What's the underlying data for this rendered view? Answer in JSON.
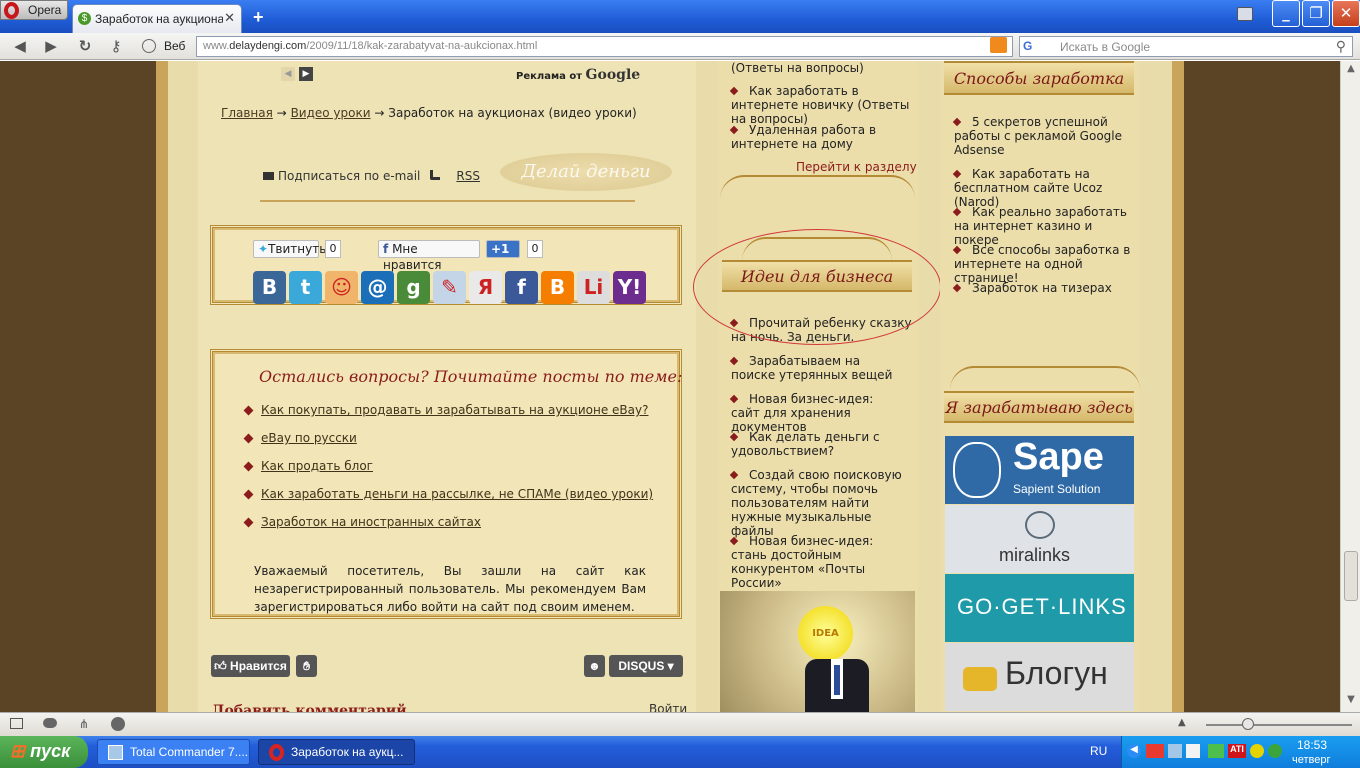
{
  "browser": {
    "menu_label": "Opera",
    "tab_title": "Заработок на аукциона...",
    "tab_favicon": "$",
    "new_tab": "+",
    "window_controls": [
      "_",
      "❐",
      "✕"
    ]
  },
  "toolbar": {
    "web_label": "Веб",
    "address_prefix": "www.",
    "address_domain": "delaydengi.com",
    "address_path": "/2009/11/18/kak-zarabatyvat-na-aukcionax.html",
    "search_engine": "G",
    "search_placeholder": "Искать в Google"
  },
  "ad": {
    "label": "Реклама от",
    "brand": "Google"
  },
  "breadcrumb": {
    "home": "Главная",
    "sep": "→",
    "section": "Видео уроки",
    "current": "Заработок на аукционах (видео уроки)"
  },
  "subscribe": {
    "email": "Подписаться по e-mail",
    "rss": "RSS"
  },
  "logo_watermark": "Делай деньги",
  "share": {
    "tweet": "Твитнуть",
    "tweet_count": "0",
    "fb_like": "Мне нравится",
    "plus_one": "+1",
    "plus_count": "0",
    "icons": [
      {
        "name": "vkontakte-icon",
        "glyph": "B",
        "color": "#3b6798"
      },
      {
        "name": "twitter-icon",
        "glyph": "t",
        "color": "#3aa9d9"
      },
      {
        "name": "odnoklassniki-icon",
        "glyph": "☺",
        "color": "#f1b46b"
      },
      {
        "name": "mailru-icon",
        "glyph": "@",
        "color": "#1b6fb8"
      },
      {
        "name": "google-icon",
        "glyph": "g",
        "color": "#4a8b3a"
      },
      {
        "name": "livejournal-icon",
        "glyph": "✎",
        "color": "#c5d5e8"
      },
      {
        "name": "yandex-icon",
        "glyph": "Я",
        "color": "#e9e9e9"
      },
      {
        "name": "facebook-icon",
        "glyph": "f",
        "color": "#3b5998"
      },
      {
        "name": "blogger-icon",
        "glyph": "B",
        "color": "#f57d00"
      },
      {
        "name": "liveinternet-icon",
        "glyph": "Li",
        "color": "#dddddd"
      },
      {
        "name": "yahoo-icon",
        "glyph": "Y!",
        "color": "#6d2d8f"
      }
    ]
  },
  "related": {
    "title": "Остались вопросы? Почитайте посты по теме:",
    "items": [
      "Как покупать, продавать и зарабатывать на аукционе eBay?",
      "eBay по русски",
      "Как продать блог",
      "Как заработать деньги на рассылке, не СПАМе (видео уроки)",
      "Заработок на иностранных сайтах"
    ],
    "notice": "Уважаемый посетитель, Вы зашли на сайт как незарегистрированный пользователь. Мы рекомендуем Вам зарегистрироваться либо войти на сайт под своим именем."
  },
  "comments": {
    "like_label": "Нравится",
    "disqus_label": "DISQUS",
    "heading": "Добавить комментарий",
    "login": "Войти"
  },
  "midcol": {
    "top_items": [
      "(Ответы на вопросы)",
      "Как заработать в интернете новичку (Ответы на вопросы)",
      "Удаленная работа в интернете на дому"
    ],
    "goto": "Перейти к разделу",
    "ideas_title": "Идеи для бизнеса",
    "ideas": [
      "Прочитай ребенку сказку на ночь. За деньги.",
      "Зарабатываем на поиске утерянных вещей",
      "Новая бизнес-идея: сайт для хранения документов",
      "Как делать деньги с удовольствием?",
      "Создай свою поисковую систему, чтобы помочь пользователям найти нужные музыкальные файлы",
      "Новая бизнес-идея: стань достойным конкурентом «Почты России»"
    ],
    "idea_bulb": "IDEA"
  },
  "rightcol": {
    "ways_title": "Способы заработка",
    "ways": [
      "5 секретов успешной работы с рекламой Google Adsense",
      "Как заработать на бесплатном сайте Ucoz (Narod)",
      "Как реально заработать на интернет казино и покере",
      "Все способы заработка в интернете на одной странице!",
      "Заработок на тизерах"
    ],
    "earn_title": "Я зарабатываю здесь",
    "banners": [
      {
        "name": "sape-banner",
        "title": "Sape",
        "sub": "Sapient Solution",
        "color": "#2f6aa7"
      },
      {
        "name": "miralinks-banner",
        "title": "miralinks",
        "sub": "",
        "color": "#dfe3e8"
      },
      {
        "name": "gogetlinks-banner",
        "title": "GO·GET·LINKS",
        "sub": "",
        "color": "#1e9aa9"
      },
      {
        "name": "blogun-banner",
        "title": "Блогун",
        "sub": "",
        "color": "#dcdcdc"
      }
    ]
  },
  "taskbar": {
    "start": "пуск",
    "tasks": [
      "Total Commander 7....",
      "Заработок на аукц..."
    ],
    "lang": "RU",
    "time": "18:53",
    "day": "четверг"
  }
}
